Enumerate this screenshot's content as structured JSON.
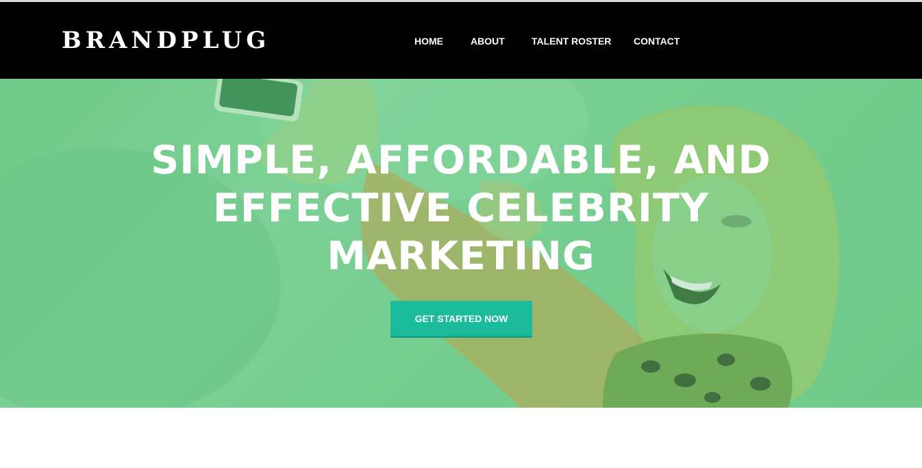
{
  "brand": {
    "name": "BRANDPLUG"
  },
  "nav": {
    "items": [
      {
        "label": "HOME"
      },
      {
        "label": "ABOUT"
      },
      {
        "label": "TALENT ROSTER"
      },
      {
        "label": "CONTACT"
      }
    ]
  },
  "hero": {
    "title_line1": "SIMPLE, AFFORDABLE, AND",
    "title_line2": "EFFECTIVE CELEBRITY",
    "title_line3": "MARKETING",
    "cta_label": "GET STARTED NOW"
  },
  "colors": {
    "navbar_bg": "#000000",
    "hero_overlay": "#7ccf92",
    "cta_bg": "#1abc9c",
    "text": "#ffffff"
  }
}
